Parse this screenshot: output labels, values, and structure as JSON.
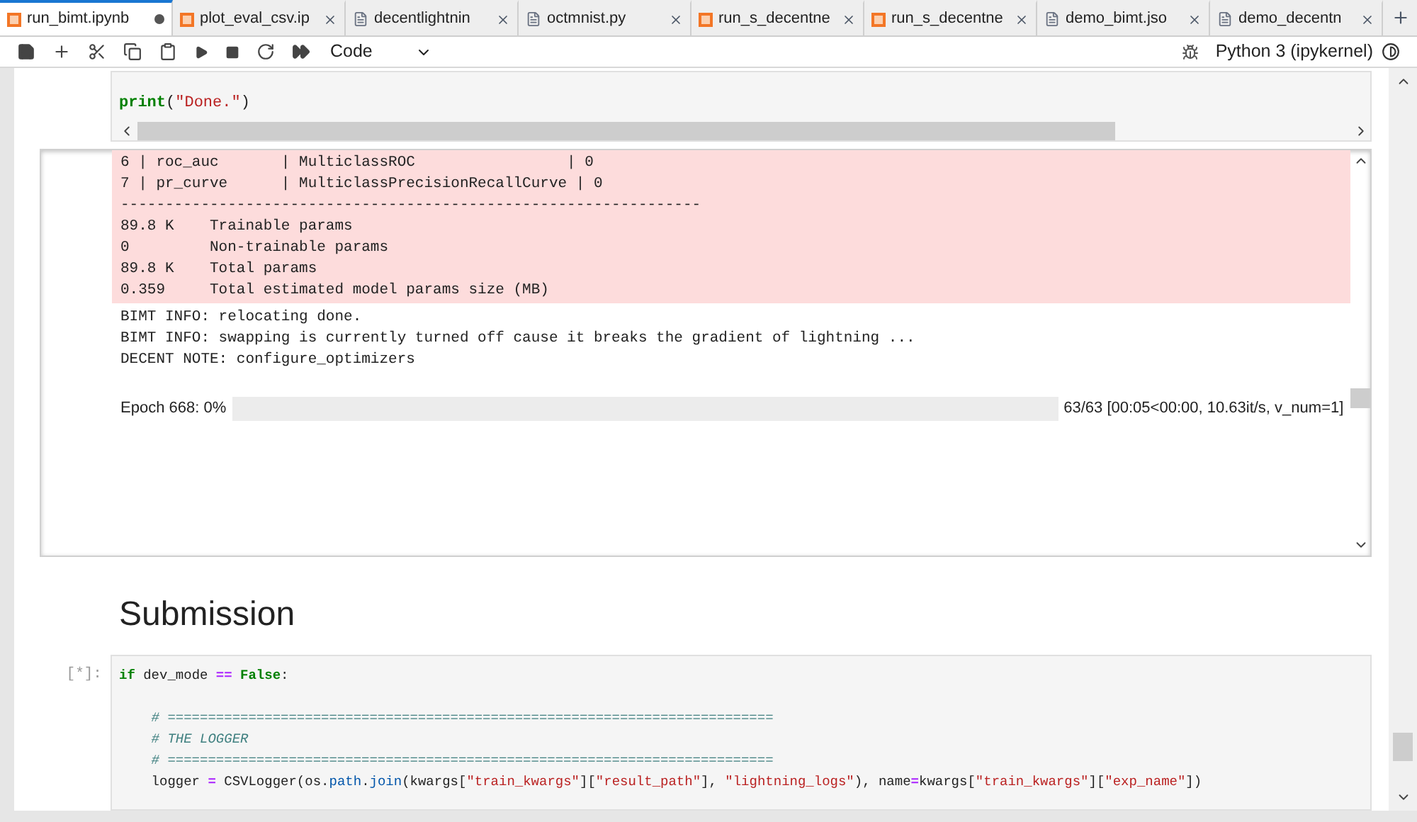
{
  "tabs": [
    {
      "label": "run_bimt.ipynb",
      "kind": "notebook",
      "selected": true,
      "modified": true
    },
    {
      "label": "plot_eval_csv.ip",
      "kind": "notebook",
      "selected": false,
      "modified": false
    },
    {
      "label": "decentlightnin",
      "kind": "text",
      "selected": false,
      "modified": false
    },
    {
      "label": "octmnist.py",
      "kind": "text",
      "selected": false,
      "modified": false
    },
    {
      "label": "run_s_decentne",
      "kind": "notebook",
      "selected": false,
      "modified": false
    },
    {
      "label": "run_s_decentne",
      "kind": "notebook",
      "selected": false,
      "modified": false
    },
    {
      "label": "demo_bimt.jso",
      "kind": "text",
      "selected": false,
      "modified": false
    },
    {
      "label": "demo_decentn",
      "kind": "text",
      "selected": false,
      "modified": false
    }
  ],
  "toolbar": {
    "cell_type": "Code",
    "kernel": "Python 3 (ipykernel)"
  },
  "cell_1": {
    "code": [
      {
        "tokens": [
          {
            "kind": "kw",
            "text": "print"
          },
          {
            "kind": "plain",
            "text": "("
          },
          {
            "kind": "str",
            "text": "\"Done.\""
          },
          {
            "kind": "plain",
            "text": ")"
          }
        ]
      }
    ],
    "stderr": [
      "6 | roc_auc       | MulticlassROC                 | 0",
      "7 | pr_curve      | MulticlassPrecisionRecallCurve | 0",
      "-----------------------------------------------------------------",
      "89.8 K    Trainable params",
      "0         Non-trainable params",
      "89.8 K    Total params",
      "0.359     Total estimated model params size (MB)"
    ],
    "stdout": [
      "BIMT INFO: relocating done.",
      "BIMT INFO: swapping is currently turned off cause it breaks the gradient of lightning ...",
      "DECENT NOTE: configure_optimizers"
    ],
    "progress": {
      "label": "Epoch 668: 0%",
      "level": 0,
      "reading": "63/63 [00:05<00:00, 10.63it/s, v_num=1]"
    }
  },
  "heading": "Submission",
  "cell_2": {
    "prompt": "[*]:",
    "code": [
      {
        "tokens": [
          {
            "kind": "kw",
            "text": "if"
          },
          {
            "kind": "plain",
            "text": " dev_mode "
          },
          {
            "kind": "op",
            "text": "=="
          },
          {
            "kind": "kw",
            "text": " False"
          },
          {
            "kind": "plain",
            "text": ":"
          }
        ]
      },
      {
        "space_before": true,
        "tokens": [
          {
            "kind": "comment",
            "text": "    # ==========================================================================="
          }
        ]
      },
      {
        "tokens": [
          {
            "kind": "comment",
            "text": "    # THE LOGGER"
          }
        ]
      },
      {
        "tokens": [
          {
            "kind": "comment",
            "text": "    # ==========================================================================="
          }
        ]
      },
      {
        "tokens": [
          {
            "kind": "plain",
            "text": "    logger "
          },
          {
            "kind": "op",
            "text": "="
          },
          {
            "kind": "plain",
            "text": " CSVLogger(os."
          },
          {
            "kind": "attr",
            "text": "path"
          },
          {
            "kind": "plain",
            "text": "."
          },
          {
            "kind": "attr",
            "text": "join"
          },
          {
            "kind": "plain",
            "text": "(kwargs["
          },
          {
            "kind": "str",
            "text": "\"train_kwargs\""
          },
          {
            "kind": "plain",
            "text": "]["
          },
          {
            "kind": "str",
            "text": "\"result_path\""
          },
          {
            "kind": "plain",
            "text": "], "
          },
          {
            "kind": "str",
            "text": "\"lightning_logs\""
          },
          {
            "kind": "plain",
            "text": "), name"
          },
          {
            "kind": "op",
            "text": "="
          },
          {
            "kind": "plain",
            "text": "kwargs["
          },
          {
            "kind": "str",
            "text": "\"train_kwargs\""
          },
          {
            "kind": "plain",
            "text": "]["
          },
          {
            "kind": "str",
            "text": "\"exp_name\""
          },
          {
            "kind": "plain",
            "text": "])"
          }
        ]
      }
    ]
  }
}
